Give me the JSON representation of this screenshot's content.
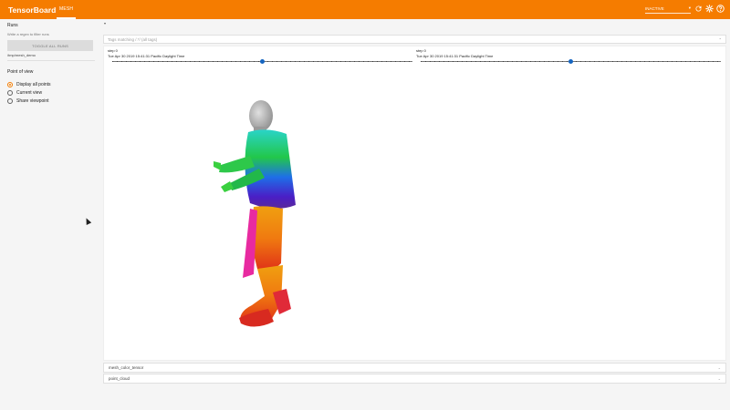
{
  "header": {
    "brand": "TensorBoard",
    "active_tab": "MESH",
    "status_label": "INACTIVE",
    "status_caret": "▾",
    "icons": [
      "refresh-icon",
      "gear-icon",
      "help-icon"
    ],
    "accent_color": "#f57c00"
  },
  "sidebar": {
    "runs_title": "Runs",
    "filter_hint": "Write a regex to filter runs",
    "toggle_label": "TOGGLE ALL RUNS",
    "run_name": "/tmp/mesh_demo",
    "pov_title": "Point of view",
    "options": [
      {
        "label": "Display all points",
        "selected": true
      },
      {
        "label": "Current view",
        "selected": false
      },
      {
        "label": "Share viewpoint",
        "selected": false
      }
    ]
  },
  "main": {
    "collapse_caret": "▾",
    "tag_filter_label": "Tags matching /.*/ (all tags)",
    "tag_filter_icon": "⌃",
    "panels": [
      {
        "step": "step 0",
        "date": "Tue Apr 30 2019 15:41:31 Pacific Daylight Time",
        "slider_value": 0.5
      },
      {
        "step": "step 0",
        "date": "Tue Apr 30 2019 15:41:31 Pacific Daylight Time",
        "slider_value": 0.5
      }
    ],
    "tag_rows": [
      {
        "label": "mesh_color_tensor",
        "expander": "⌄"
      },
      {
        "label": "point_cloud",
        "expander": "⌄"
      }
    ]
  }
}
